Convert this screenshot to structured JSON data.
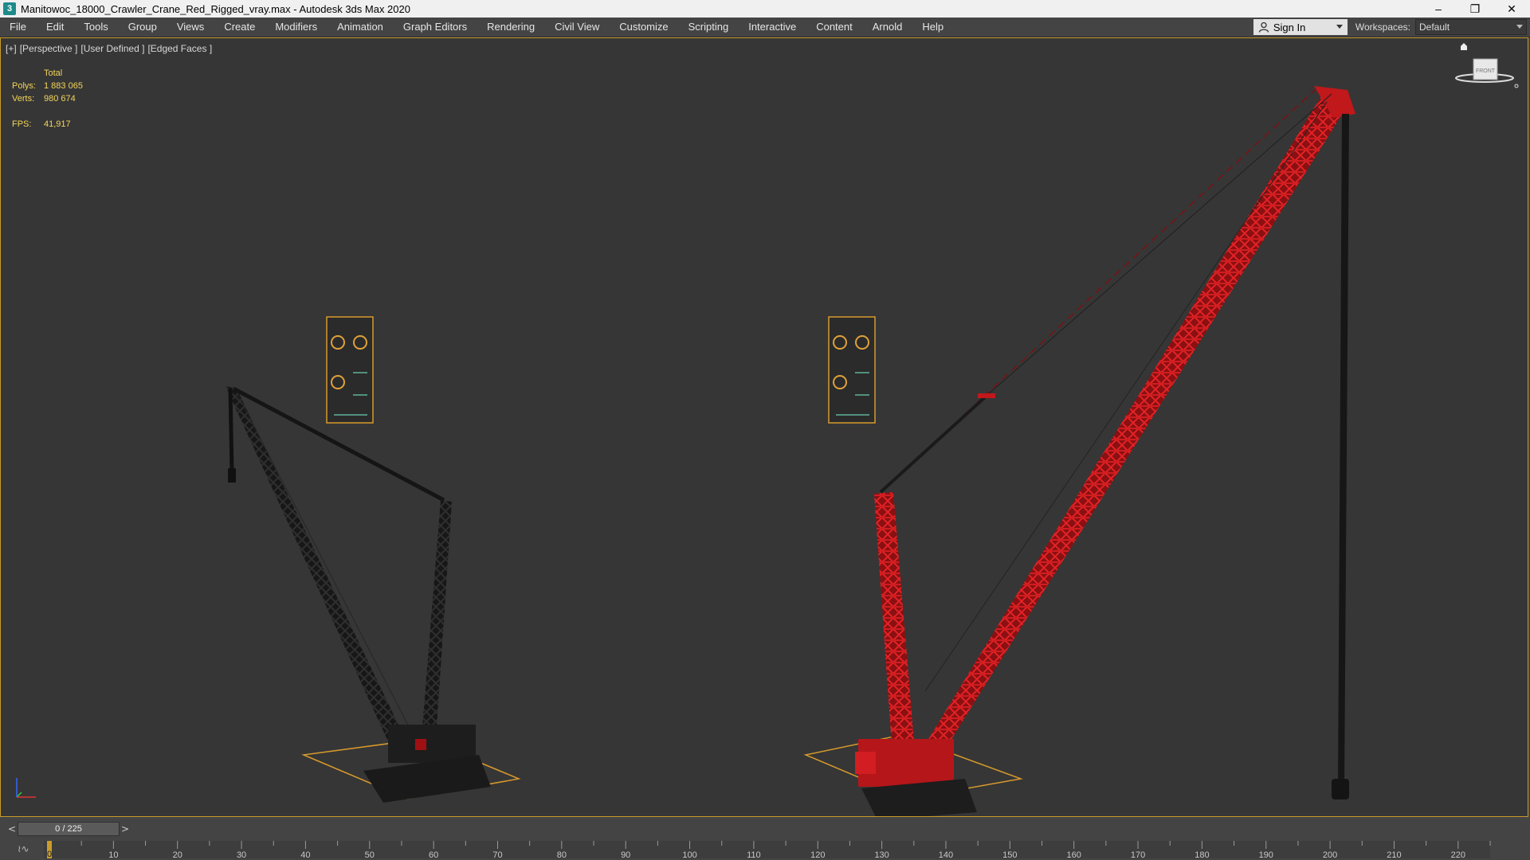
{
  "window": {
    "title": "Manitowoc_18000_Crawler_Crane_Red_Rigged_vray.max - Autodesk 3ds Max 2020",
    "app_icon": "3",
    "minimize": "–",
    "restore": "❐",
    "close": "✕"
  },
  "menu": {
    "items": [
      "File",
      "Edit",
      "Tools",
      "Group",
      "Views",
      "Create",
      "Modifiers",
      "Animation",
      "Graph Editors",
      "Rendering",
      "Civil View",
      "Customize",
      "Scripting",
      "Interactive",
      "Content",
      "Arnold",
      "Help"
    ],
    "sign_in": "Sign In",
    "workspaces_label": "Workspaces:",
    "workspace": "Default"
  },
  "viewport": {
    "labels": [
      "[+]",
      "[Perspective ]",
      "[User Defined ]",
      "[Edged Faces ]"
    ],
    "stats": {
      "total_label": "Total",
      "polys_label": "Polys:",
      "polys": "1 883 065",
      "verts_label": "Verts:",
      "verts": "980 674",
      "fps_label": "FPS:",
      "fps": "41,917"
    },
    "viewcube_label": "FRONT"
  },
  "timeline": {
    "frame_display": "0 / 225",
    "prev": "<",
    "next": ">",
    "ticks": [
      0,
      10,
      20,
      30,
      40,
      50,
      60,
      70,
      80,
      90,
      100,
      110,
      120,
      130,
      140,
      150,
      160,
      170,
      180,
      190,
      200,
      210,
      220
    ],
    "frame_max": 225,
    "current_frame": 0
  },
  "colors": {
    "accent": "#c99d2a",
    "crane_red": "#c0181b",
    "crane_dark": "#1f1f1f",
    "stats_yellow": "#f3d55a"
  }
}
